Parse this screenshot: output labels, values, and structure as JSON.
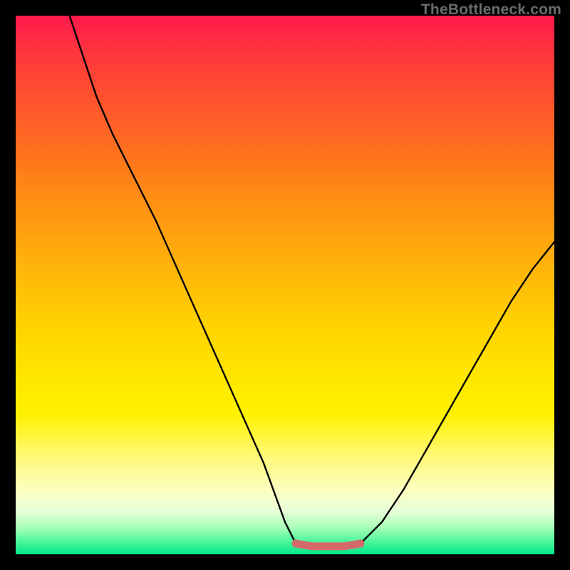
{
  "watermark": "TheBottleneck.com",
  "colors": {
    "curve": "#000000",
    "highlight": "#d46a6a",
    "background_top": "#ff1a4d",
    "background_bottom": "#00e88a",
    "frame": "#000000"
  },
  "chart_data": {
    "type": "line",
    "title": "",
    "xlabel": "",
    "ylabel": "",
    "xlim": [
      0,
      100
    ],
    "ylim": [
      0,
      100
    ],
    "grid": false,
    "series": [
      {
        "name": "left-branch",
        "x": [
          10,
          15,
          18,
          22,
          26,
          30,
          34,
          38,
          42,
          46,
          50,
          52
        ],
        "y": [
          100,
          85,
          78,
          70,
          62,
          53,
          44,
          35,
          26,
          17,
          6,
          2
        ]
      },
      {
        "name": "valley-floor",
        "x": [
          52,
          55,
          58,
          61,
          64
        ],
        "y": [
          2,
          1.5,
          1.5,
          1.5,
          2
        ]
      },
      {
        "name": "right-branch",
        "x": [
          64,
          68,
          72,
          76,
          80,
          84,
          88,
          92,
          96,
          100
        ],
        "y": [
          2,
          6,
          12,
          19,
          26,
          33,
          40,
          47,
          53,
          58
        ]
      }
    ],
    "highlight_segment": {
      "name": "optimal-zone",
      "x": [
        52,
        55,
        58,
        61,
        64
      ],
      "y": [
        2,
        1.5,
        1.5,
        1.5,
        2
      ]
    }
  }
}
